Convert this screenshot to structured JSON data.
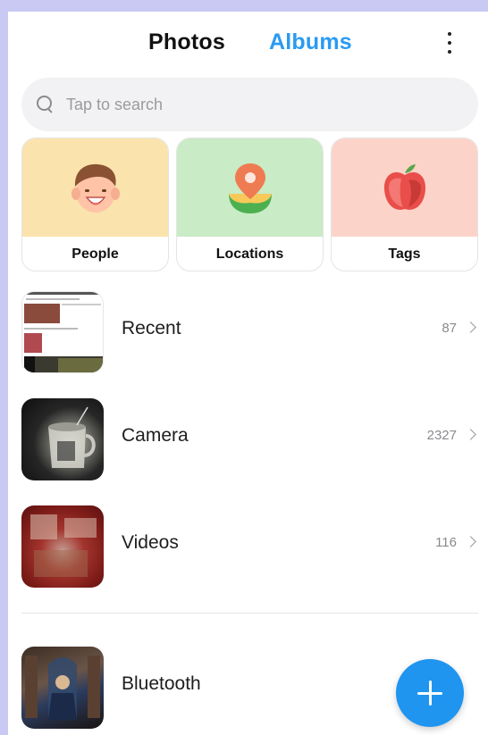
{
  "header": {
    "tabs": [
      {
        "label": "Photos",
        "active": false
      },
      {
        "label": "Albums",
        "active": true
      }
    ],
    "more_icon": "more-vertical-icon"
  },
  "search": {
    "placeholder": "Tap to search",
    "icon": "search-icon"
  },
  "categories": [
    {
      "label": "People",
      "icon": "person-face-icon",
      "bg": "#fae3ad"
    },
    {
      "label": "Locations",
      "icon": "map-pin-icon",
      "bg": "#c9ebc5"
    },
    {
      "label": "Tags",
      "icon": "apple-tag-icon",
      "bg": "#fcd3c9"
    }
  ],
  "albums": [
    {
      "name": "Recent",
      "count": "87"
    },
    {
      "name": "Camera",
      "count": "2327"
    },
    {
      "name": "Videos",
      "count": "116"
    },
    {
      "name": "Bluetooth",
      "count": ""
    }
  ],
  "fab": {
    "icon": "plus-icon"
  },
  "colors": {
    "accent": "#2a9af2",
    "fab": "#1f95f0"
  }
}
